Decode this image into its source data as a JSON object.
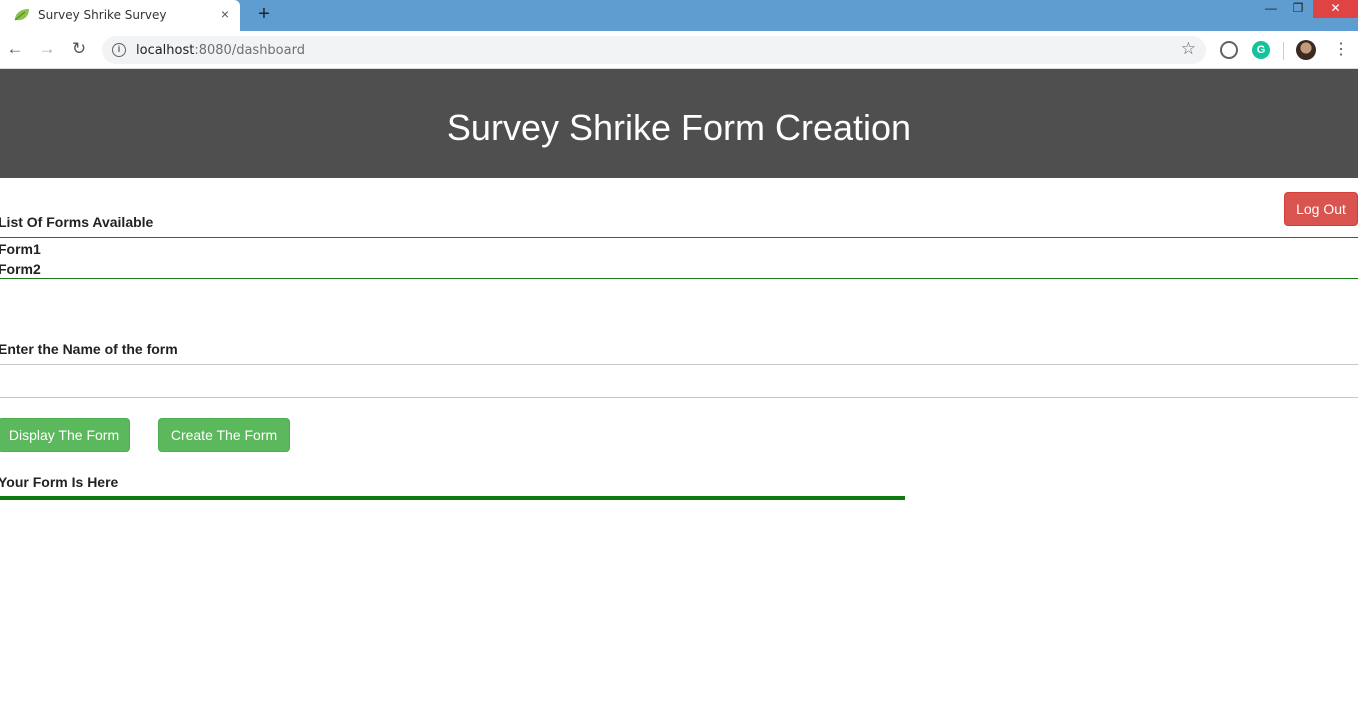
{
  "browser": {
    "tab_title": "Survey Shrike Survey",
    "tab_close": "×",
    "new_tab": "+",
    "url_host": "localhost",
    "url_path": ":8080/dashboard",
    "window_controls": {
      "minimize": "—",
      "maximize": "❐",
      "close": "✕"
    }
  },
  "header": {
    "title": "Survey Shrike Form Creation"
  },
  "actions": {
    "logout_label": "Log Out"
  },
  "forms_list": {
    "label": "List Of Forms Available",
    "items": [
      "Form1",
      "Form2"
    ]
  },
  "form_name": {
    "label": "Enter the Name of the form",
    "value": ""
  },
  "buttons": {
    "display_label": "Display The Form",
    "create_label": "Create The Form"
  },
  "output": {
    "label": "Your Form Is Here"
  },
  "colors": {
    "header_bg": "#4f4f4f",
    "logout_bg": "#d9534f",
    "button_bg": "#5cb85c",
    "rule_green": "#0f7a0f"
  }
}
